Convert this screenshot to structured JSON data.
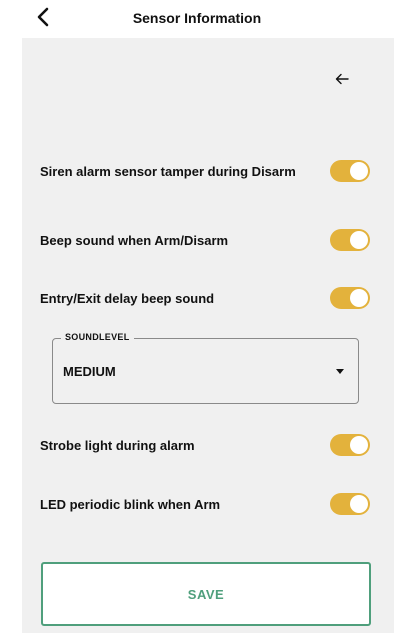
{
  "header": {
    "title": "Sensor Information",
    "back_icon": "chevron-left-icon"
  },
  "panel": {
    "back_icon": "arrow-left-icon"
  },
  "colors": {
    "toggle_on": "#e3b23c",
    "accent_green": "#4f9f7c",
    "panel_bg": "#f0f0f0"
  },
  "settings": [
    {
      "label": "Siren alarm sensor tamper during Disarm",
      "enabled": true
    },
    {
      "label": "Beep sound when Arm/Disarm",
      "enabled": true
    },
    {
      "label": "Entry/Exit delay beep sound",
      "enabled": true
    },
    {
      "label": "Strobe light during alarm",
      "enabled": true
    },
    {
      "label": "LED periodic blink when Arm",
      "enabled": true
    }
  ],
  "soundlevel": {
    "legend": "SOUNDLEVEL",
    "value": "MEDIUM"
  },
  "actions": {
    "save_label": "SAVE"
  }
}
